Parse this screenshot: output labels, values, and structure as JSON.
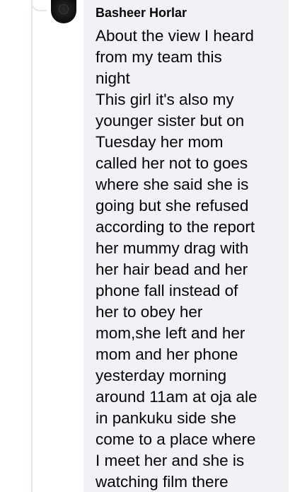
{
  "comment": {
    "author": "Basheer Horlar",
    "lines": [
      "About the view I heard",
      "from my team this",
      "night",
      "This girl it's also my",
      "younger sister but on",
      "Tuesday her mom",
      "called her not to goes",
      "where she said she is",
      "going but she refused",
      "according to the report",
      "her mummy drag with",
      "her hair bead and her",
      "phone fall instead of",
      "her to obey her",
      "mom,she left and her",
      "mom and her phone",
      "yesterday morning",
      "around 11am at oja ale",
      "in pankuku side she",
      "come to a place where",
      "I meet her and she is",
      "watching film there"
    ]
  },
  "colors": {
    "bubble_bg": "#f0f2f5",
    "text": "#050505",
    "thread_line": "#e4e6eb"
  }
}
